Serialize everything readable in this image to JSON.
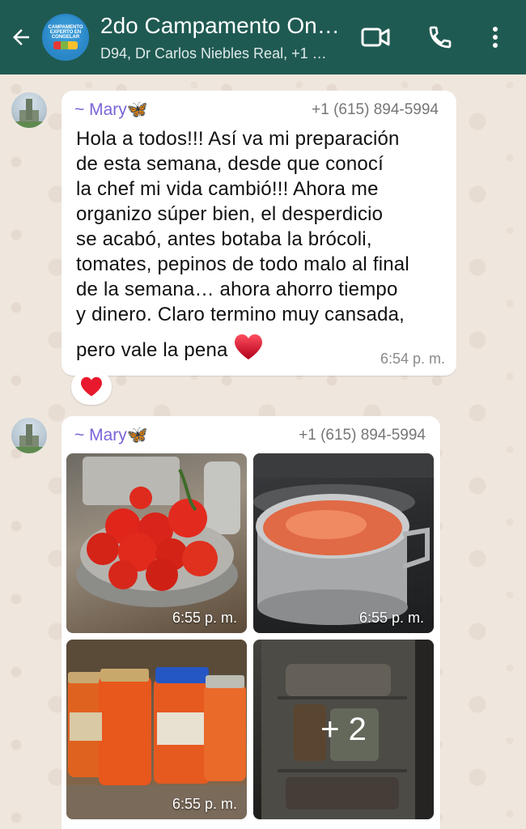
{
  "header": {
    "title": "2do Campamento On…",
    "subtitle": "D94, Dr Carlos Niebles Real, +1 …",
    "avatar_text": "CAMPAMENTO EXPERTO EN CONGELAR",
    "bg_color": "#1f5a52"
  },
  "messages": [
    {
      "sender": "~ Mary🦋",
      "phone": "+1 (615) 894-5994",
      "lines": [
        "Hola a todos!!! Así va mi preparación",
        "de esta semana, desde que conocí",
        "la chef mi vida cambió!!! Ahora me",
        "organizo súper bien, el desperdicio",
        "se acabó, antes botaba la brócoli,",
        "tomates, pepinos de todo malo al final",
        "de la semana… ahora ahorro tiempo",
        "y dinero. Claro termino muy cansada,",
        "pero vale la pena"
      ],
      "time": "6:54 p. m.",
      "reaction": "heart"
    },
    {
      "sender": "~ Mary🦋",
      "phone": "+1 (615) 894-5994",
      "photos": [
        {
          "time": "6:55 p. m."
        },
        {
          "time": "6:55 p. m."
        },
        {
          "time": "6:55 p. m."
        }
      ],
      "more_label": "+ 2"
    }
  ],
  "colors": {
    "sender": "#7b64d8",
    "wallpaper": "#efe7de"
  }
}
